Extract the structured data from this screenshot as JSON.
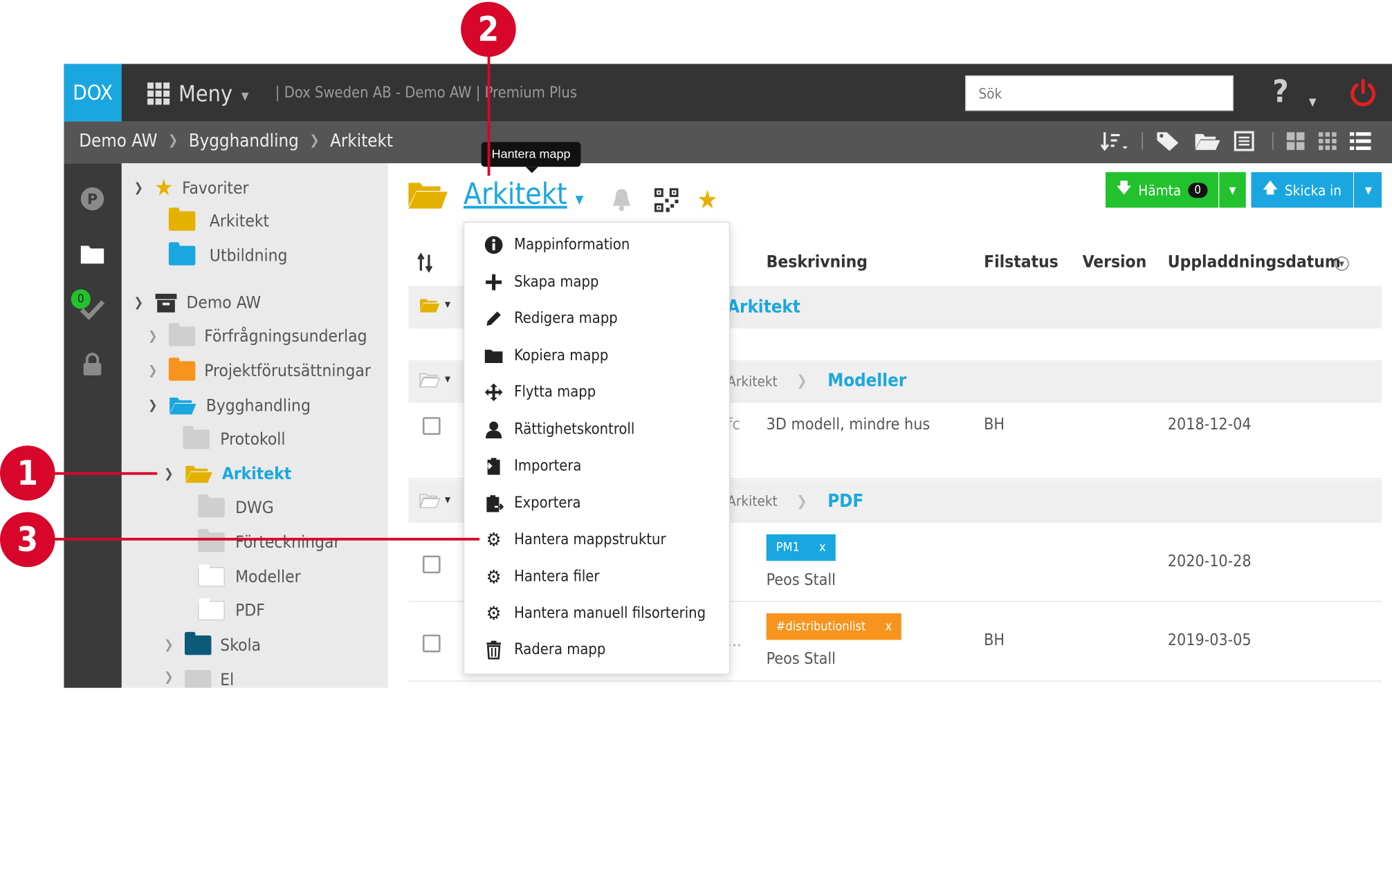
{
  "header": {
    "logo": "DOX",
    "menu_label": "Meny",
    "company_text": "| Dox Sweden AB - Demo AW | Premium Plus",
    "search_placeholder": "Sök",
    "help_label": "?"
  },
  "breadcrumb": [
    "Demo AW",
    "Bygghandling",
    "Arkitekt"
  ],
  "sidebar_badge": "0",
  "tree": {
    "favorites_label": "Favoriter",
    "favorites": [
      "Arkitekt",
      "Utbildning"
    ],
    "root": "Demo AW",
    "items": [
      "Förfrågningsunderlag",
      "Projektförutsättningar",
      "Bygghandling",
      "Protokoll",
      "Arkitekt",
      "DWG",
      "Förteckningar",
      "Modeller",
      "PDF",
      "Skola",
      "El"
    ]
  },
  "folder": {
    "title": "Arkitekt",
    "tooltip": "Hantera mapp"
  },
  "buttons": {
    "hamta": "Hämta",
    "hamta_count": "0",
    "skicka": "Skicka in"
  },
  "columns": {
    "beskrivning": "Beskrivning",
    "filstatus": "Filstatus",
    "version": "Version",
    "uppladdning": "Uppladdningsdatum"
  },
  "groups": {
    "g1": "Arkitekt",
    "g2_parent": "Arkitekt",
    "g2_name": "Modeller",
    "g3_parent": "Arkitekt",
    "g3_name": "PDF"
  },
  "rows": {
    "r1_frag": "fc",
    "r1_desc": "3D modell, mindre hus",
    "r1_status": "BH",
    "r1_date": "2018-12-04",
    "r2_tag": "PM1",
    "r2_desc": "Peos Stall",
    "r2_date": "2020-10-28",
    "r3_frag": "…",
    "r3_tag": "#distributionlist",
    "r3_desc": "Peos Stall",
    "r3_status": "BH",
    "r3_date": "2019-03-05",
    "tag_remove": "x"
  },
  "menu": [
    "Mappinformation",
    "Skapa mapp",
    "Redigera mapp",
    "Kopiera mapp",
    "Flytta mapp",
    "Rättighetskontroll",
    "Importera",
    "Exportera",
    "Hantera mappstruktur",
    "Hantera filer",
    "Hantera manuell filsortering",
    "Radera mapp"
  ],
  "callouts": [
    "1",
    "2",
    "3"
  ],
  "colors": {
    "accent": "#1aa7e0",
    "green": "#22c22e",
    "callout": "#d7062a",
    "folder_yellow": "#e5b100",
    "folder_orange": "#f7941d"
  }
}
